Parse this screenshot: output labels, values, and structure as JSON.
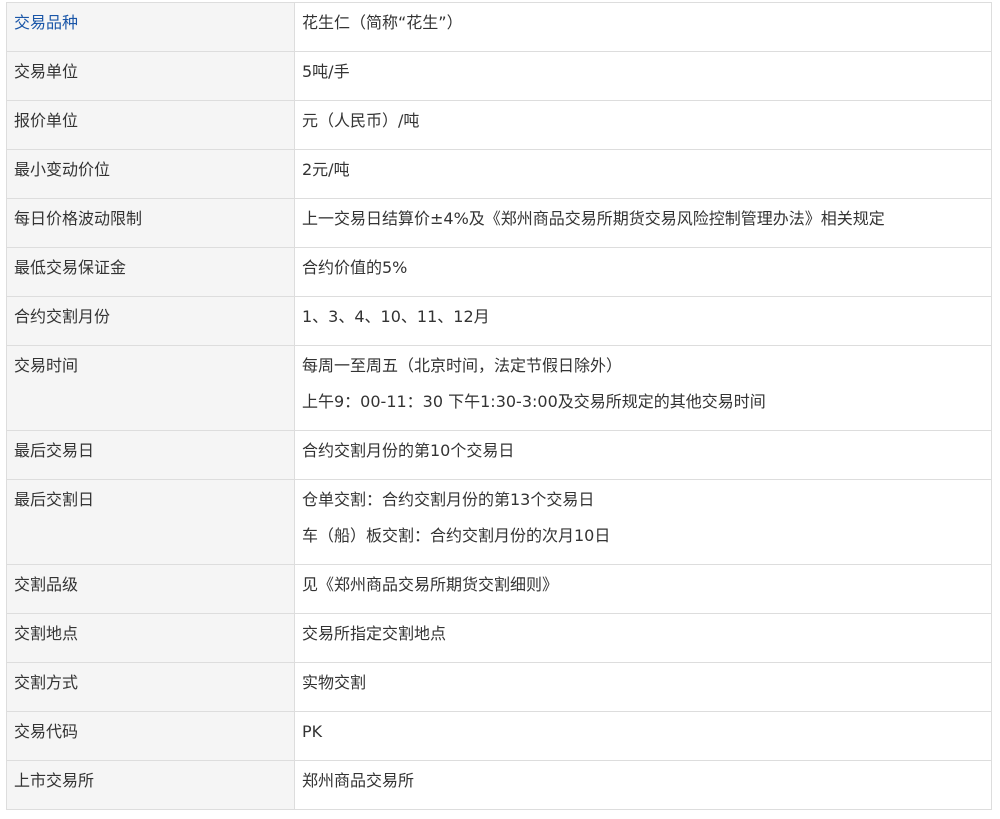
{
  "rows": [
    {
      "label": "交易品种",
      "values": [
        "花生仁（简称“花生”）"
      ]
    },
    {
      "label": "交易单位",
      "values": [
        "5吨/手"
      ]
    },
    {
      "label": "报价单位",
      "values": [
        "元（人民币）/吨"
      ]
    },
    {
      "label": "最小变动价位",
      "values": [
        "2元/吨"
      ]
    },
    {
      "label": "每日价格波动限制",
      "values": [
        "上一交易日结算价±4%及《郑州商品交易所期货交易风险控制管理办法》相关规定"
      ]
    },
    {
      "label": "最低交易保证金",
      "values": [
        "合约价值的5%"
      ]
    },
    {
      "label": "合约交割月份",
      "values": [
        "1、3、4、10、11、12月"
      ]
    },
    {
      "label": "交易时间",
      "values": [
        "每周一至周五（北京时间，法定节假日除外）",
        "上午9：00-11：30  下午1:30-3:00及交易所规定的其他交易时间"
      ]
    },
    {
      "label": "最后交易日",
      "values": [
        "合约交割月份的第10个交易日"
      ]
    },
    {
      "label": "最后交割日",
      "values": [
        "仓单交割：合约交割月份的第13个交易日",
        "车（船）板交割：合约交割月份的次月10日"
      ]
    },
    {
      "label": "交割品级",
      "values": [
        "见《郑州商品交易所期货交割细则》"
      ]
    },
    {
      "label": "交割地点",
      "values": [
        "交易所指定交割地点"
      ]
    },
    {
      "label": "交割方式",
      "values": [
        "实物交割"
      ]
    },
    {
      "label": "交易代码",
      "values": [
        "PK"
      ]
    },
    {
      "label": "上市交易所",
      "values": [
        "郑州商品交易所"
      ]
    }
  ]
}
